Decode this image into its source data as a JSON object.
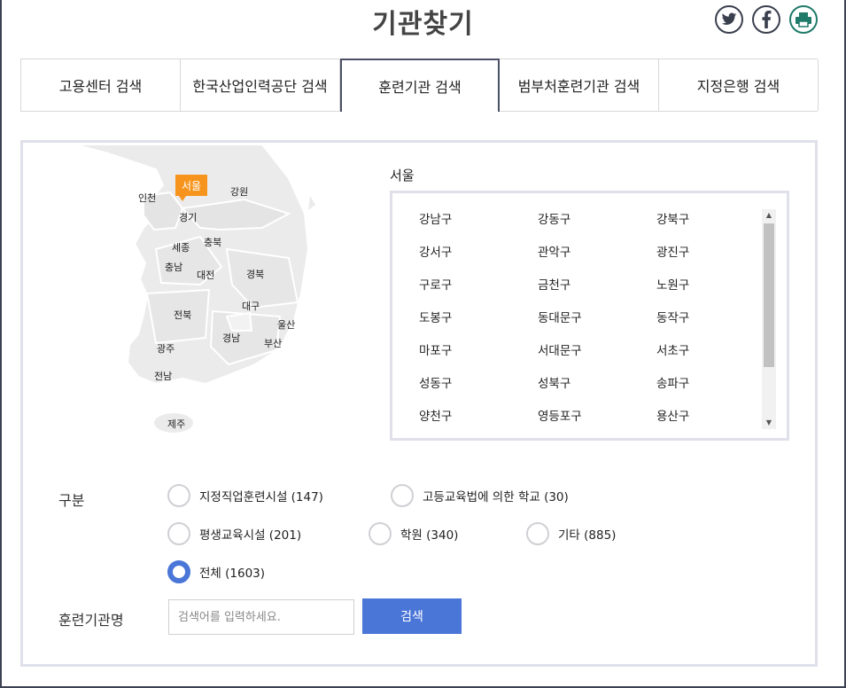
{
  "header": {
    "title": "기관찾기"
  },
  "social": {
    "twitter_icon": "twitter-icon",
    "facebook_icon": "facebook-icon",
    "print_icon": "print-icon"
  },
  "tabs": [
    {
      "label": "고용센터 검색"
    },
    {
      "label": "한국산업인력공단 검색"
    },
    {
      "label": "훈련기관 검색"
    },
    {
      "label": "범부처훈련기관 검색"
    },
    {
      "label": "지정은행 검색"
    }
  ],
  "map": {
    "selected": "서울",
    "regions": [
      "인천",
      "서울",
      "강원",
      "경기",
      "세종",
      "충북",
      "충남",
      "대전",
      "경북",
      "대구",
      "울산",
      "전북",
      "경남",
      "부산",
      "광주",
      "전남",
      "제주"
    ]
  },
  "district_panel": {
    "title": "서울",
    "districts": [
      "강남구",
      "강동구",
      "강북구",
      "강서구",
      "관악구",
      "광진구",
      "구로구",
      "금천구",
      "노원구",
      "도봉구",
      "동대문구",
      "동작구",
      "마포구",
      "서대문구",
      "서초구",
      "성동구",
      "성북구",
      "송파구",
      "양천구",
      "영등포구",
      "용산구"
    ]
  },
  "filter": {
    "label": "구분",
    "options": [
      {
        "label": "지정직업훈련시설 (147)",
        "checked": false
      },
      {
        "label": "고등교육법에 의한 학교 (30)",
        "checked": false
      },
      {
        "label": "평생교육시설 (201)",
        "checked": false
      },
      {
        "label": "학원 (340)",
        "checked": false
      },
      {
        "label": "기타 (885)",
        "checked": false
      },
      {
        "label": "전체 (1603)",
        "checked": true
      }
    ]
  },
  "search": {
    "label": "훈련기관명",
    "placeholder": "검색어를 입력하세요.",
    "button": "검색"
  },
  "colors": {
    "accent": "#4a76d8",
    "badge": "#f7941d",
    "map_land": "#ebebeb"
  }
}
